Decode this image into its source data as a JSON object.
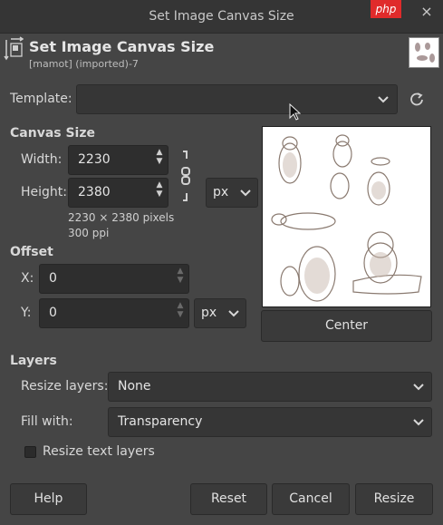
{
  "window": {
    "title": "Set Image Canvas Size",
    "brand": "php",
    "close": "×"
  },
  "header": {
    "title": "Set Image Canvas Size",
    "subtitle": "[mamot] (imported)-7"
  },
  "template": {
    "label": "Template:",
    "value": ""
  },
  "canvas_size": {
    "section": "Canvas Size",
    "width_label": "Width:",
    "width_value": "2230",
    "height_label": "Height:",
    "height_value": "2380",
    "unit": "px",
    "pixels_info": "2230 × 2380 pixels",
    "ppi_info": "300 ppi"
  },
  "offset": {
    "section": "Offset",
    "x_label": "X:",
    "x_value": "0",
    "y_label": "Y:",
    "y_value": "0",
    "unit": "px"
  },
  "center_label": "Center",
  "layers": {
    "section": "Layers",
    "resize_label": "Resize layers:",
    "resize_value": "None",
    "fill_label": "Fill with:",
    "fill_value": "Transparency",
    "resize_text_label": "Resize text layers",
    "resize_text_checked": false
  },
  "buttons": {
    "help": "Help",
    "reset": "Reset",
    "cancel": "Cancel",
    "resize": "Resize"
  },
  "icons": {
    "header": "canvas-size-icon",
    "template_reset": "reset-icon",
    "chain": "chain-link-icon",
    "dropdown": "chevron-down-icon",
    "cursor": "mouse-pointer-icon"
  },
  "colors": {
    "background": "#454545",
    "field": "#2e2e2e",
    "titlebar": "#353535"
  }
}
